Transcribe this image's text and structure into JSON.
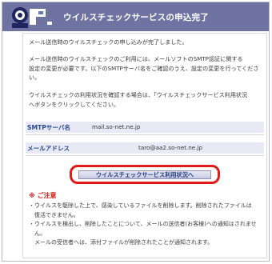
{
  "header": {
    "title": "ウイルスチェックサービスの申込完了"
  },
  "main": {
    "para1": "メール送信時のウイルスチェックの申し込みが完了しました。",
    "para2_line1": "メール送信時のウイルスチェックのご利用には、メールソフトのSMTP認証に関する",
    "para2_line2": "設定の変更が必要です。以下のSMTPサーバ名をご確認のうえ、設定の変更を行ってくださ",
    "para2_line3": "い。",
    "para3_line1": "ウイルスチェックの利用状況を確認する場合は、「ウイルスチェックサービス利用状況",
    "para3_line2": "へボタンをクリックしてください。",
    "smtp_label": "SMTPサーバ名",
    "smtp_value": "mail.so-net.ne.jp",
    "mail_label": "メールアドレス",
    "mail_value": "taro@aa2.so-net.ne.jp",
    "button_label": "ウイルスチェックサービス利用状況へ"
  },
  "notes": {
    "title": "※ ご注意",
    "line1": "・ウイルスを駆除した上で、感染しているファイルを削除します。削除されたファイルは",
    "line2": "復活できません。",
    "line3": "・ウイルスを検出し、削除したことについて、メールの送信者(お客様)への通知はされませ",
    "line4": "ん。",
    "line5": "メールの受信者へは、添付ファイルが削除されたことが通知されます。"
  },
  "colors": {
    "header_bg": "#6f73a2",
    "highlight_border": "#e11a1a",
    "note_title": "#d81b1b",
    "row_bg": "#e9e9f6"
  },
  "icons": {
    "logo": "so-net-logo-icon"
  }
}
